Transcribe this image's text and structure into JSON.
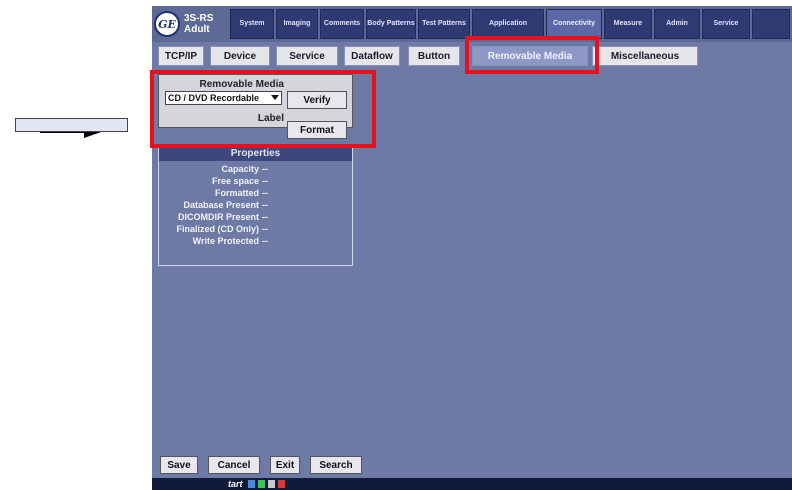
{
  "probe": {
    "line1": "3S-RS",
    "line2": "Adult"
  },
  "logo": {
    "text": "GE"
  },
  "main_tabs": [
    {
      "label": "System"
    },
    {
      "label": "Imaging"
    },
    {
      "label": "Comments"
    },
    {
      "label": "Body Patterns"
    },
    {
      "label": "Test Patterns"
    },
    {
      "label": "Application"
    },
    {
      "label": "Connectivity",
      "active": true
    },
    {
      "label": "Measure"
    },
    {
      "label": "Admin"
    },
    {
      "label": "Service"
    }
  ],
  "sub_tabs": [
    {
      "label": "TCP/IP"
    },
    {
      "label": "Device"
    },
    {
      "label": "Service"
    },
    {
      "label": "Dataflow"
    },
    {
      "label": "Button"
    },
    {
      "label": "Removable Media",
      "active": true
    },
    {
      "label": "Miscellaneous"
    }
  ],
  "removable_media": {
    "title": "Removable Media",
    "selected": "CD / DVD Recordable",
    "verify_label": "Verify",
    "label_caption": "Label",
    "label_value": "",
    "format_label": "Format"
  },
  "properties": {
    "header": "Properties",
    "rows": [
      {
        "name": "Capacity",
        "value": "--"
      },
      {
        "name": "Free space",
        "value": "--"
      },
      {
        "name": "Formatted",
        "value": "--"
      },
      {
        "name": "Database Present",
        "value": "--"
      },
      {
        "name": "DICOMDIR Present",
        "value": "--"
      },
      {
        "name": "Finalized (CD Only)",
        "value": "--"
      },
      {
        "name": "Write Protected",
        "value": "--"
      }
    ]
  },
  "bottom_buttons": {
    "save": "Save",
    "cancel": "Cancel",
    "exit": "Exit",
    "search": "Search"
  },
  "taskbar": {
    "start": "tart"
  },
  "colors": {
    "highlight": "#e8101a",
    "screen_bg": "#6e7aa6",
    "tab_active": "#8e98c6"
  }
}
